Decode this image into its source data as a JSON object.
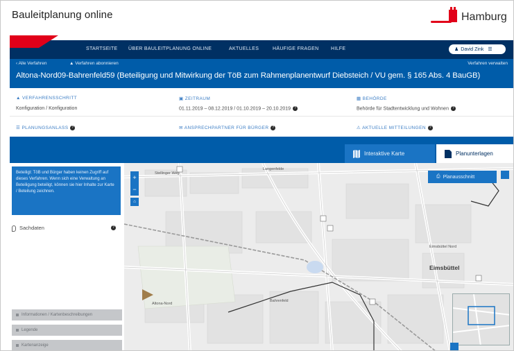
{
  "header": {
    "app_title": "Bauleitplanung online",
    "brand": "Hamburg",
    "accent_color": "#e10019"
  },
  "nav": {
    "items": [
      "STARTSEITE",
      "ÜBER BAULEITPLANUNG ONLINE",
      "AKTUELLES",
      "HÄUFIGE FRAGEN",
      "HILFE"
    ],
    "user": "David Zink"
  },
  "procedure": {
    "back_link": "‹ Alle Verfahren",
    "subscribe": "Verfahren abonnieren",
    "manage": "Verfahren verwalten",
    "title": "Altona-Nord09-Bahrenfeld59 (Beteiligung und Mitwirkung der TöB zum Rahmenplanentwurf Diebsteich / VU gem. § 165 Abs. 4 BauGB)"
  },
  "info": {
    "step_head": "VERFAHRENSSCHRITT",
    "step_value": "Konfiguration / Konfiguration",
    "period_head": "ZEITRAUM",
    "period_value": "01.11.2019 – 08.12.2019 / 01.10.2019 – 20.10.2019",
    "authority_head": "BEHÖRDE",
    "authority_value": "Behörde für Stadtentwicklung und Wohnen",
    "docs_link": "PLANUNGSANLASS",
    "contact_link": "ANSPRECHPARTNER FÜR BÜRGER",
    "news_link": "AKTUELLE MITTEILUNGEN"
  },
  "tabs": {
    "map": "Interaktive Karte",
    "documents": "Planunterlagen"
  },
  "sidebar": {
    "info_text": "Beteiligt: TöB und Bürger haben keinen Zugriff auf dieses Verfahren. Wenn sich eine Verwaltung an Beteiligung beteiligt, können sie hier Inhalte zur Karte / Beteilung zeichnen.",
    "layer_label": "Sachdaten",
    "accordions": [
      "Informationen / Kartenbeschreibungen",
      "Legende",
      "Kartenanzeige"
    ]
  },
  "map": {
    "print_button": "Planausschnitt",
    "labels": [
      "Eimsbüttel",
      "Lang­enfelde",
      "Altona-Nord",
      "Bahrenfeld",
      "Eimsbüttel Nord",
      "Stellinger Weg"
    ]
  }
}
